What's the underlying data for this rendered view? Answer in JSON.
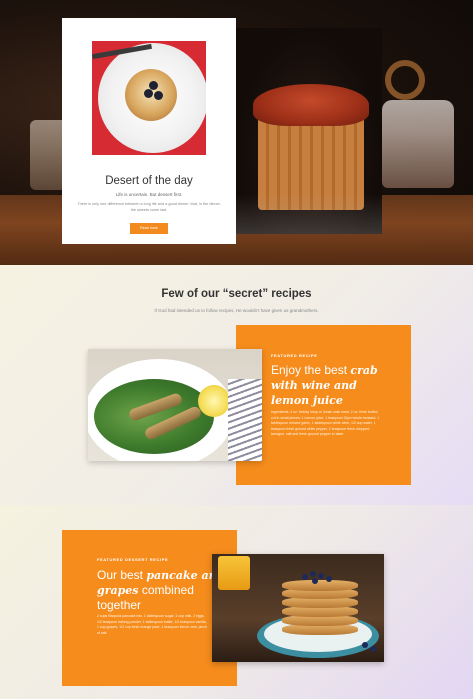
{
  "hero": {
    "card": {
      "title": "Desert of the day",
      "subtitle": "Life is uncertain. But dessert first.",
      "body": "There is only one difference between a long life and a good dinner: that, in the dinner, the sweets come last.",
      "button_label": "Read more"
    }
  },
  "recipes": {
    "heading": "Few of our “secret” recipes",
    "subheading": "If God had intended us to follow recipes, He wouldn’t have given us grandmothers.",
    "featured": {
      "eyebrow": "FEATURED RECIPE",
      "title_plain": "Enjoy the best ",
      "title_emphasis": "crab with wine and lemon juice",
      "body": "Ingredients: 4 oz. freshly lump or Jonah crab meat, 2 oz. fresh boiled, cut in small pieces: 1 Lemon juice, 1 teaspoon Dijon whole mustard, 1 tablespoon minced garlic, 1 tablespoon white wine, 1/2 cup water, 1 teaspoon fresh ground white pepper, 2 teaspoon fresh chopped tarragon, salt and fresh ground pepper to taste."
    }
  },
  "dessert": {
    "featured": {
      "eyebrow": "FEATURED DESSERT RECIPE",
      "title_plain_1": "Our best ",
      "title_emphasis": "pancake and grapes",
      "title_plain_2": " combined together",
      "body": "2 cups Bisquick pancake mix, 1 tablespoon sugar, 1 cup milk, 2 eggs, 1/2 teaspoon baking powder, 1 tablespoon butter, 1/2 teaspoon vanilla, 1 cup grapes, 1/2 cup fresh orange juice, 1 teaspoon lemon zest, pinch of salt."
    }
  },
  "colors": {
    "accent": "#f58c1c",
    "card_bg": "#ffffff",
    "text_dark": "#333333"
  }
}
